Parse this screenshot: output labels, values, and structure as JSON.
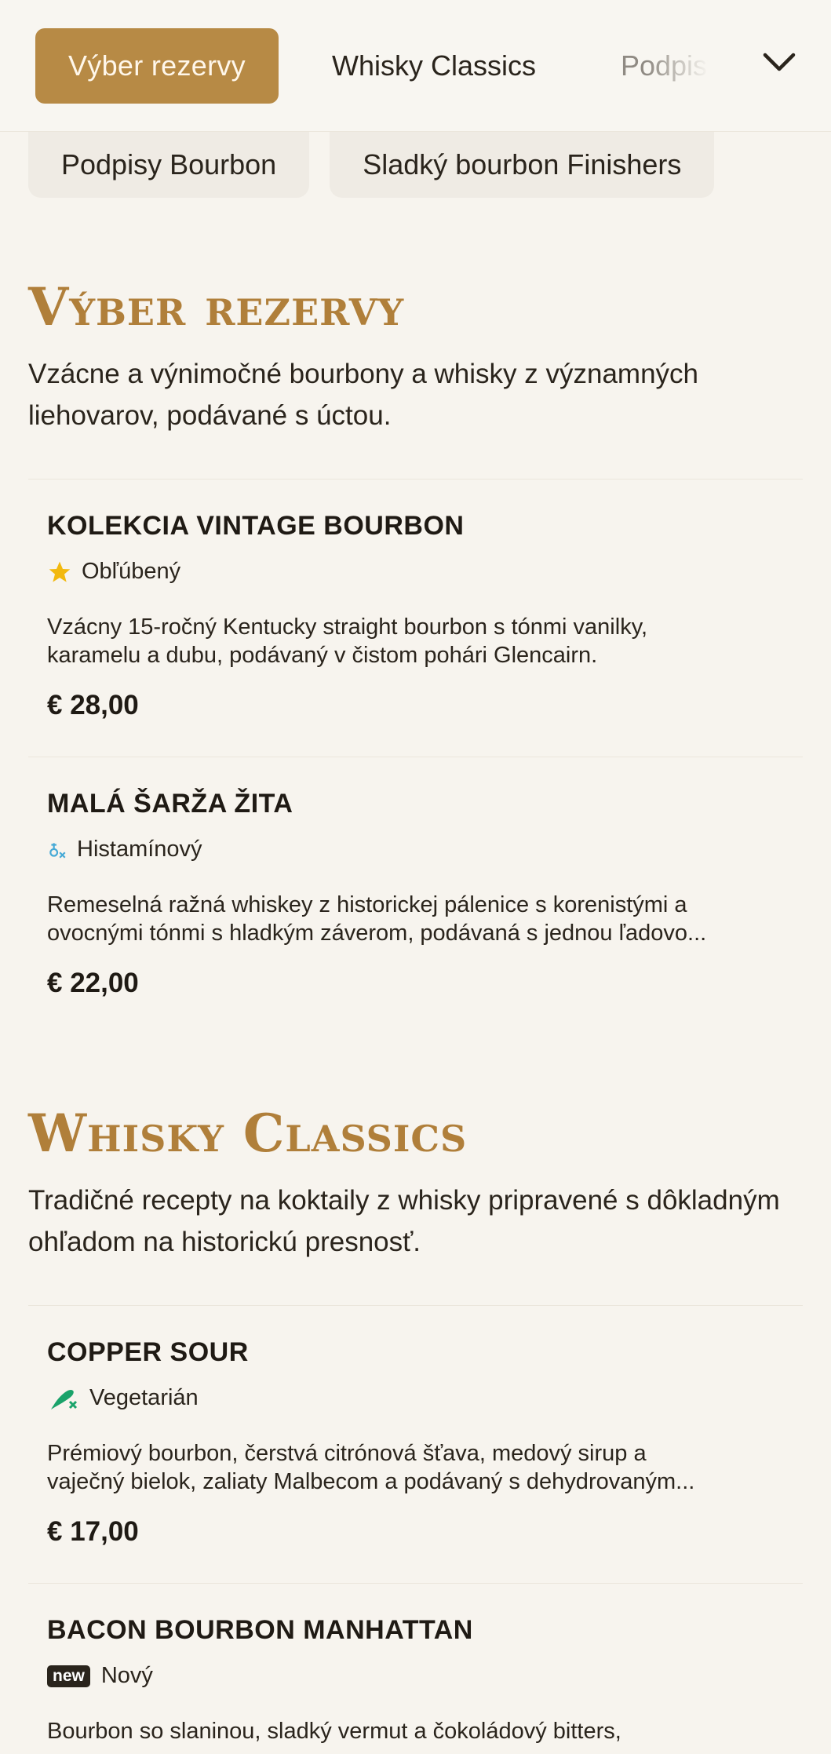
{
  "tabs": {
    "active": "Výber rezervy",
    "second": "Whisky Classics",
    "third": "Podpisy Bourbon"
  },
  "chips": [
    "Podpisy Bourbon",
    "Sladký bourbon Finishers"
  ],
  "sections": [
    {
      "title": "Výber rezervy",
      "description": "Vzácne a výnimočné bourbony a whisky z významných liehovarov, podávané s úctou.",
      "items": [
        {
          "name": "KOLEKCIA VINTAGE BOURBON",
          "tag": "Obľúbený",
          "tag_icon": "star-icon",
          "desc1": "Vzácny 15-ročný Kentucky straight bourbon s tónmi vanilky,",
          "desc2": "karamelu a dubu, podávaný v čistom pohári Glencairn.",
          "price": "€ 28,00"
        },
        {
          "name": "MALÁ ŠARŽA ŽITA",
          "tag": "Histamínový",
          "tag_icon": "histamine-icon",
          "desc1": "Remeselná ražná whiskey z historickej pálenice s korenistými a",
          "desc2": "ovocnými tónmi s hladkým záverom, podávaná s jednou ľadovo...",
          "price": "€ 22,00"
        }
      ]
    },
    {
      "title": "Whisky Classics",
      "description": "Tradičné recepty na koktaily z whisky pripravené s dôkladným ohľadom na historickú presnosť.",
      "items": [
        {
          "name": "COPPER SOUR",
          "tag": "Vegetarián",
          "tag_icon": "vegetarian-icon",
          "desc1": "Prémiový bourbon, čerstvá citrónová šťava, medový sirup a",
          "desc2": "vaječný bielok, zaliaty Malbecom a podávaný s dehydrovaným...",
          "price": "€ 17,00"
        },
        {
          "name": "BACON BOURBON MANHATTAN",
          "tag": "Nový",
          "tag_badge": "new",
          "desc1": "Bourbon so slaninou, sladký vermut a čokoládový bitters,"
        }
      ]
    }
  ],
  "colors": {
    "accent": "#b78a45",
    "background": "#f7f4ee",
    "star": "#f2b90f",
    "vegetarian": "#1aa36a",
    "histamine": "#45a9d6"
  }
}
